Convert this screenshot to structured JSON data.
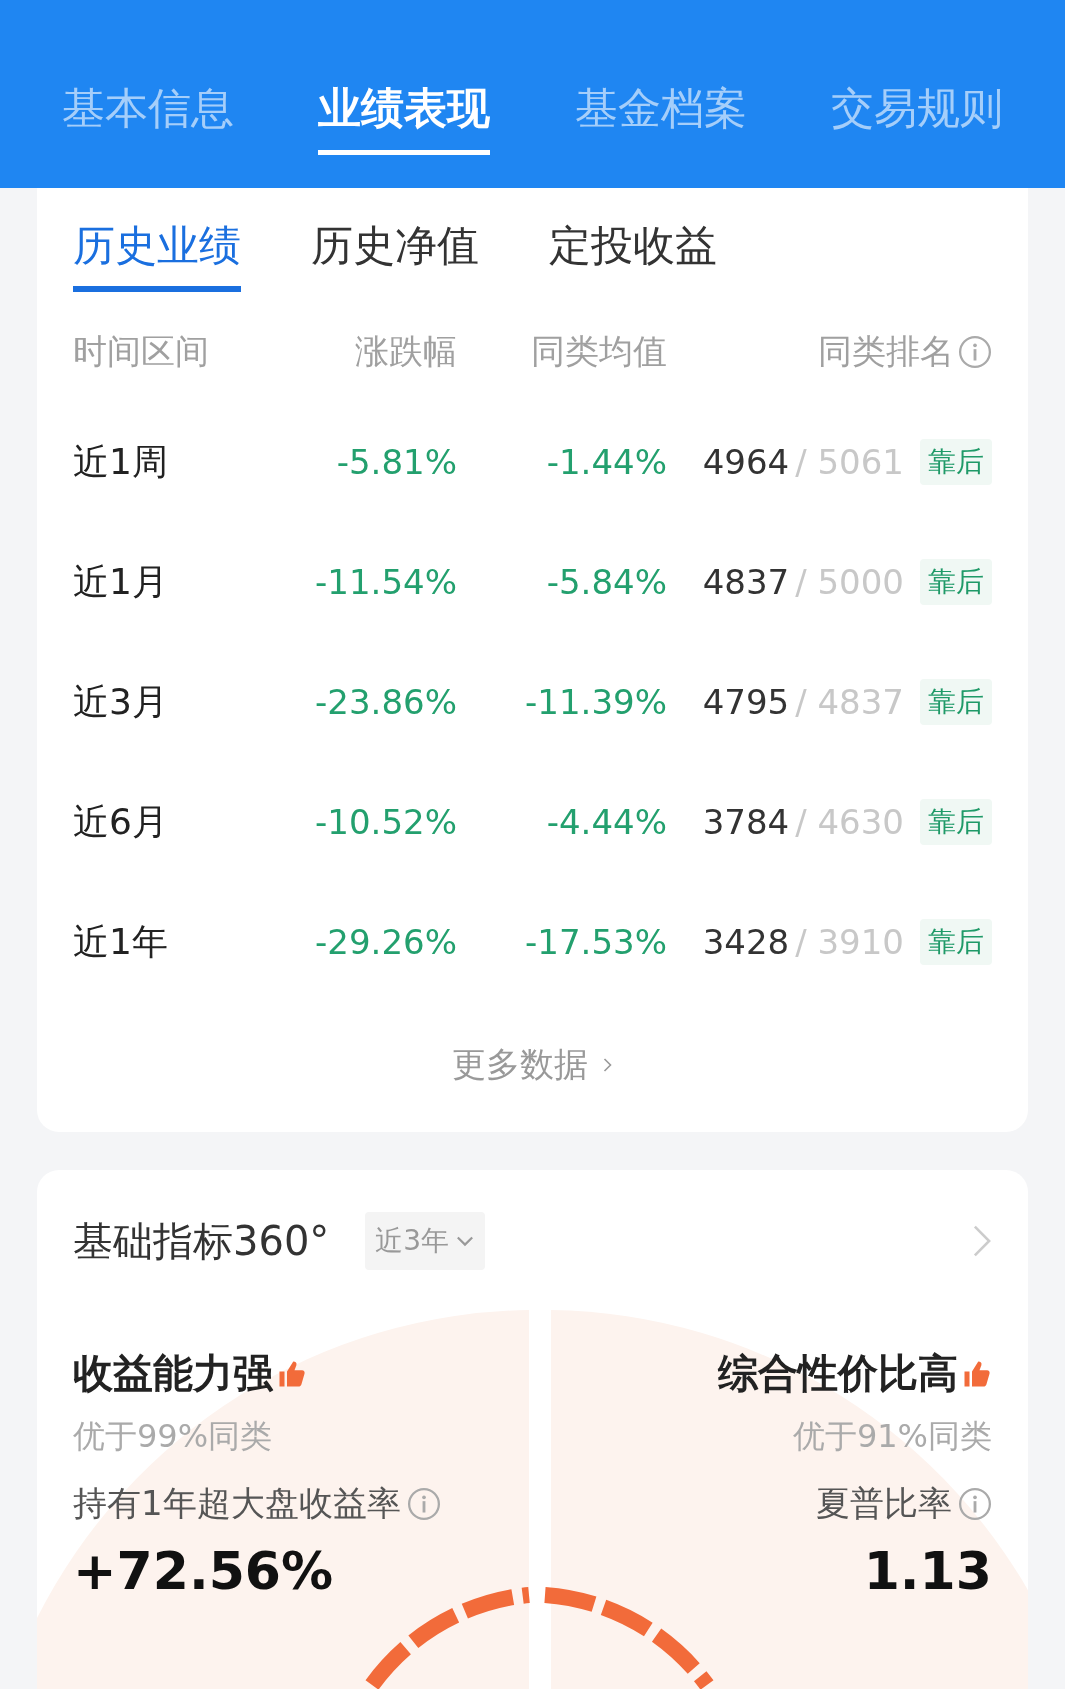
{
  "top_tabs": [
    {
      "label": "基本信息",
      "selected": false
    },
    {
      "label": "业绩表现",
      "selected": true
    },
    {
      "label": "基金档案",
      "selected": false
    },
    {
      "label": "交易规则",
      "selected": false
    }
  ],
  "sub_tabs": [
    {
      "label": "历史业绩",
      "selected": true
    },
    {
      "label": "历史净值",
      "selected": false
    },
    {
      "label": "定投收益",
      "selected": false
    }
  ],
  "table": {
    "columns": [
      "时间区间",
      "涨跌幅",
      "同类均值",
      "同类排名"
    ],
    "rows": [
      {
        "period": "近1周",
        "change": "-5.81%",
        "category_avg": "-1.44%",
        "rank": "4964",
        "total": "/ 5061",
        "badge": "靠后"
      },
      {
        "period": "近1月",
        "change": "-11.54%",
        "category_avg": "-5.84%",
        "rank": "4837",
        "total": "/ 5000",
        "badge": "靠后"
      },
      {
        "period": "近3月",
        "change": "-23.86%",
        "category_avg": "-11.39%",
        "rank": "4795",
        "total": "/ 4837",
        "badge": "靠后"
      },
      {
        "period": "近6月",
        "change": "-10.52%",
        "category_avg": "-4.44%",
        "rank": "3784",
        "total": "/ 4630",
        "badge": "靠后"
      },
      {
        "period": "近1年",
        "change": "-29.26%",
        "category_avg": "-17.53%",
        "rank": "3428",
        "total": "/ 3910",
        "badge": "靠后"
      }
    ]
  },
  "more_link": "更多数据",
  "metrics_card": {
    "title": "基础指标360°",
    "period_select": "近3年",
    "metrics": [
      {
        "heading": "收益能力强",
        "subtext": "优于99%同类",
        "label": "持有1年超大盘收益率",
        "value": "+72.56%"
      },
      {
        "heading": "综合性价比高",
        "subtext": "优于91%同类",
        "label": "夏普比率",
        "value": "1.13"
      }
    ]
  }
}
